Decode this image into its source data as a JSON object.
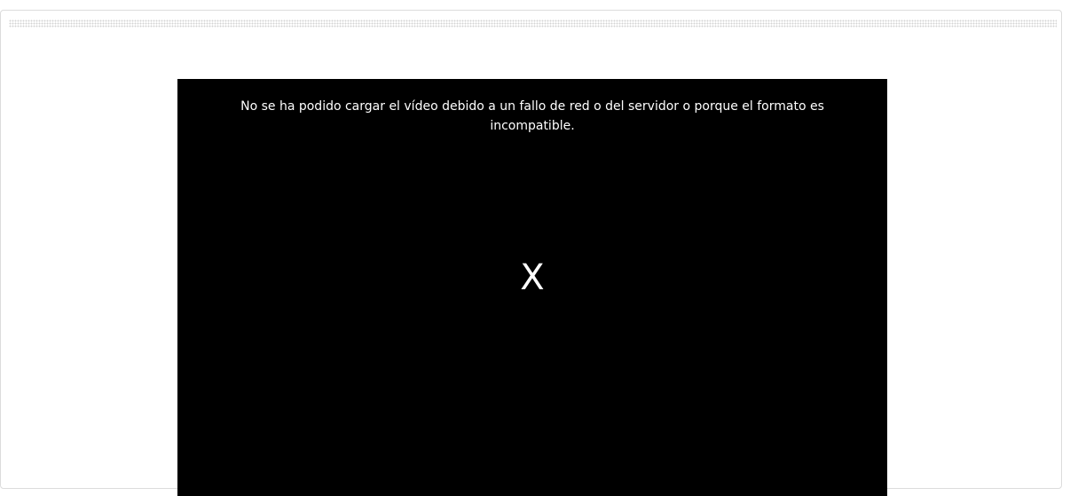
{
  "video": {
    "error_message": "No se ha podido cargar el vídeo debido a un fallo de red o del servidor o porque el formato es incompatible.",
    "error_icon": "X",
    "background_color": "#000000",
    "text_color": "#ffffff"
  }
}
